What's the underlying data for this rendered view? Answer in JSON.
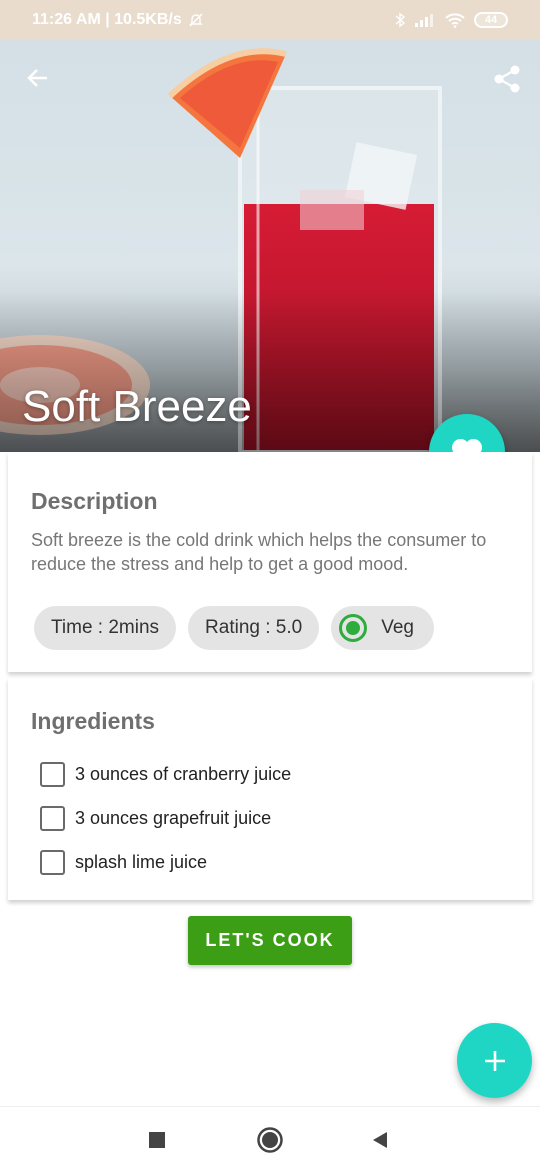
{
  "status_bar": {
    "time_speed": "11:26 AM | 10.5KB/s",
    "battery": "44"
  },
  "recipe": {
    "title": "Soft Breeze"
  },
  "description": {
    "heading": "Description",
    "text": "Soft breeze is the cold drink which helps the consumer to reduce the stress and help to get a good mood."
  },
  "chips": {
    "time": "Time : 2mins",
    "rating": "Rating : 5.0",
    "veg": "Veg"
  },
  "ingredients": {
    "heading": "Ingredients",
    "items": [
      {
        "label": "3 ounces of cranberry juice",
        "checked": false
      },
      {
        "label": "3 ounces grapefruit juice",
        "checked": false
      },
      {
        "label": "splash lime juice",
        "checked": false
      }
    ]
  },
  "cook_button": "LET'S COOK",
  "icons": {
    "back": "arrow-left-icon",
    "share": "share-icon",
    "favorite": "heart-icon",
    "add": "plus-icon",
    "nav_recent": "square-icon",
    "nav_home": "circle-icon",
    "nav_back": "triangle-icon"
  },
  "colors": {
    "accent_teal": "#1fd6c4",
    "cook_green": "#3b9e15",
    "veg_green": "#2eac3e"
  }
}
